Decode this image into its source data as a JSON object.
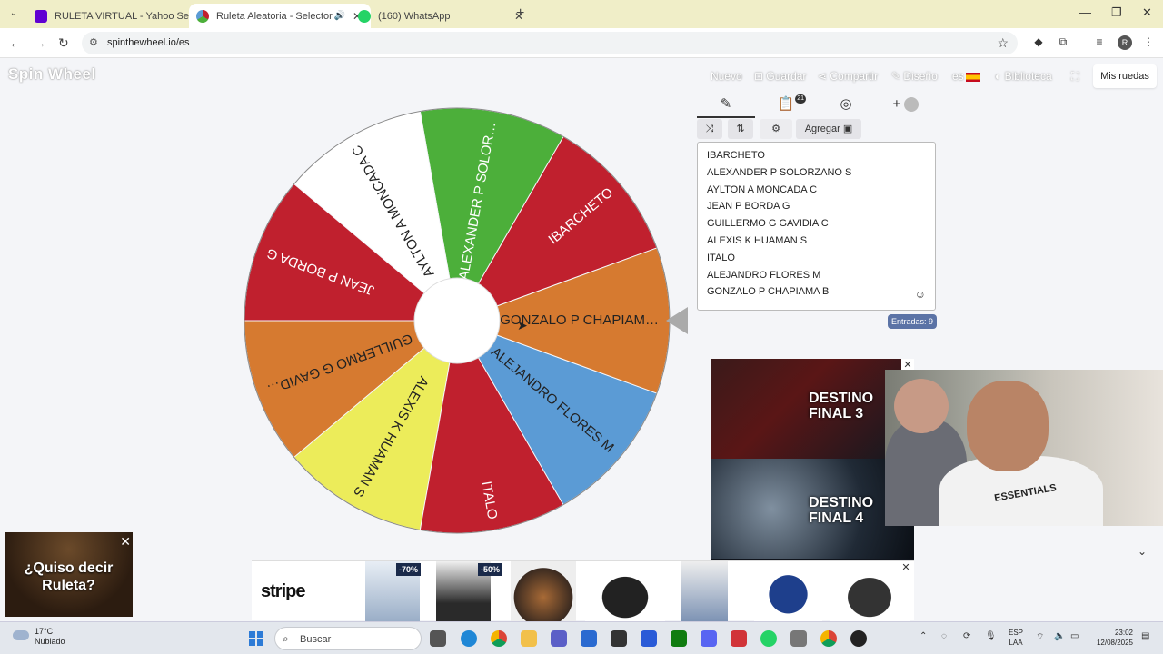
{
  "browser": {
    "tabs": [
      {
        "title": "RULETA VIRTUAL - Yahoo Search",
        "active": false,
        "favicon_color": "#6001d2"
      },
      {
        "title": "Ruleta Aleatoria - Selector P",
        "active": true,
        "favicon_color": "#ffffff"
      },
      {
        "title": "(160) WhatsApp",
        "active": false,
        "favicon_color": "#25d366"
      }
    ],
    "url": "spinthewheel.io/es"
  },
  "site": {
    "logo": "Spin Wheel",
    "menu": {
      "nuevo": "Nuevo",
      "guardar": "Guardar",
      "compartir": "Compartir",
      "diseno": "Diseño",
      "lang": "es",
      "biblioteca": "Biblioteca",
      "mis_ruedas": "Mis ruedas"
    }
  },
  "wheel": {
    "segments": [
      {
        "label": "IBARCHETO",
        "color": "#c0202e",
        "text_color": "#ffffff"
      },
      {
        "label": "ALEXANDER P SOLOR…",
        "color": "#4caf3a",
        "text_color": "#ffffff"
      },
      {
        "label": "AYLTON A MONCADA C",
        "color": "#ffffff",
        "text_color": "#222222"
      },
      {
        "label": "JEAN P BORDA G",
        "color": "#c0202e",
        "text_color": "#ffffff"
      },
      {
        "label": "GUILLERMO G GAVID…",
        "color": "#d67a30",
        "text_color": "#222222"
      },
      {
        "label": "ALEXIS K HUAMAN S",
        "color": "#ecec5a",
        "text_color": "#222222"
      },
      {
        "label": "ITALO",
        "color": "#c0202e",
        "text_color": "#ffffff"
      },
      {
        "label": "ALEJANDRO FLORES M",
        "color": "#5b9bd5",
        "text_color": "#222222"
      },
      {
        "label": "GONZALO P CHAPIAM…",
        "color": "#d67a30",
        "text_color": "#222222"
      }
    ]
  },
  "panel": {
    "tabs": {
      "edit_icon": "pencil-icon",
      "results_icon": "clipboard-icon",
      "results_badge": "21",
      "hide_icon": "eye-slash-icon",
      "add_label": "+"
    },
    "buttons": {
      "shuffle_icon": "shuffle-icon",
      "sort_icon": "sort-icon",
      "settings_icon": "gear-icon",
      "add_image": "Agregar"
    },
    "entries": [
      "IBARCHETO",
      "ALEXANDER P SOLORZANO S",
      "AYLTON A MONCADA C",
      "JEAN P BORDA G",
      "GUILLERMO G GAVIDIA C",
      "ALEXIS K HUAMAN S",
      "ITALO",
      "ALEJANDRO FLORES M",
      "GONZALO P CHAPIAMA B"
    ],
    "entries_count": "Entradas: 9"
  },
  "ads": {
    "movie": {
      "title1": "DESTINO FINAL",
      "num1": "3",
      "title2": "DESTINO FINAL 4"
    },
    "webcam_shirt": "ESSENTIALS",
    "quiso": {
      "text": "¿Quiso decir Ruleta?"
    },
    "shop": {
      "brand": "stripe",
      "discount1": "-70%",
      "discount2": "-50%"
    }
  },
  "taskbar": {
    "weather_temp": "17°C",
    "weather_desc": "Nublado",
    "search": "Buscar",
    "lang1": "ESP",
    "lang2": "LAA",
    "time": "23:02",
    "date": "12/08/2025"
  }
}
